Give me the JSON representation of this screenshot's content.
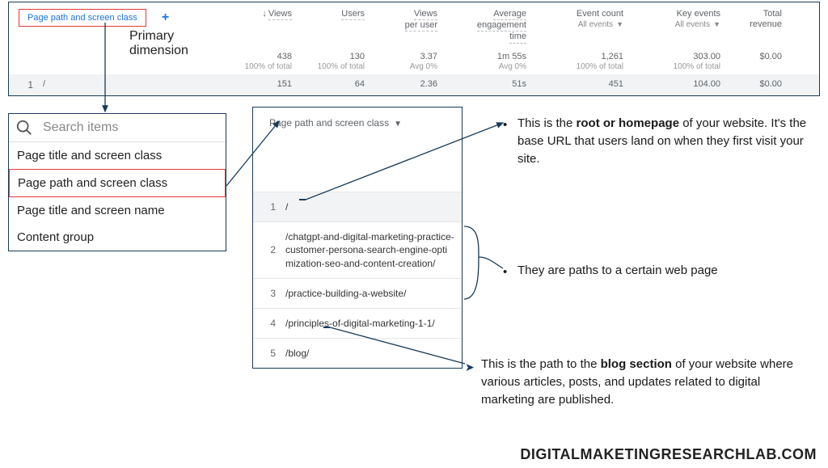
{
  "ga_table": {
    "dimension_label": "Page path and screen class",
    "columns": {
      "views": "Views",
      "users": "Users",
      "views_per_user_l1": "Views",
      "views_per_user_l2": "per user",
      "avg_eng_l1": "Average",
      "avg_eng_l2": "engagement",
      "avg_eng_l3": "time",
      "event_count_l1": "Event count",
      "event_count_l2": "All events",
      "key_events_l1": "Key events",
      "key_events_l2": "All events",
      "total_rev_l1": "Total",
      "total_rev_l2": "revenue"
    },
    "summary": {
      "views": "438",
      "views_pct": "100% of total",
      "users": "130",
      "users_pct": "100% of total",
      "vpu": "3.37",
      "vpu_pct": "Avg 0%",
      "avg_eng": "1m 55s",
      "avg_eng_pct": "Avg 0%",
      "evc": "1,261",
      "evc_pct": "100% of total",
      "key": "303.00",
      "key_pct": "100% of total",
      "rev": "$0.00"
    },
    "row1": {
      "idx": "1",
      "path": "/",
      "views": "151",
      "users": "64",
      "vpu": "2.36",
      "avg_eng": "51s",
      "evc": "451",
      "key": "104.00",
      "rev": "$0.00"
    }
  },
  "primary_dimension_label": "Primary\ndimension",
  "search_panel": {
    "placeholder": "Search items",
    "options": [
      "Page title and screen class",
      "Page path and screen class",
      "Page title and screen name",
      "Content group"
    ]
  },
  "pages_panel": {
    "heading": "Page path and screen class",
    "rows": [
      {
        "idx": "1",
        "path": "/"
      },
      {
        "idx": "2",
        "path": "/chatgpt-and-digital-marketing-practice-customer-persona-search-engine-optimization-seo-and-content-creation/"
      },
      {
        "idx": "3",
        "path": "/practice-building-a-website/"
      },
      {
        "idx": "4",
        "path": "/principles-of-digital-marketing-1-1/"
      },
      {
        "idx": "5",
        "path": "/blog/"
      }
    ]
  },
  "annotations": {
    "root_pre": "This is the ",
    "root_bold": "root or homepage",
    "root_post": " of your website. It's the base URL that users land on when they first visit your site.",
    "paths": "They are  paths to a certain web page",
    "blog_pre": "This is the path to the ",
    "blog_bold": "blog section",
    "blog_post": " of your website where various articles, posts, and updates related to digital marketing are published."
  },
  "watermark": "DIGITALMAKETINGRESEARCHLAB.COM"
}
